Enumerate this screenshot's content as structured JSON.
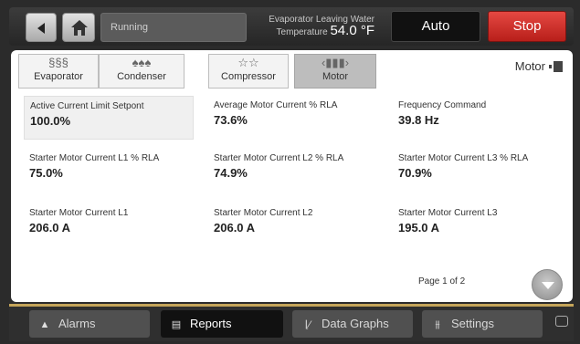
{
  "header": {
    "status": "Running",
    "temperature": {
      "label_line1": "Evaporator Leaving Water",
      "label_line2": "Temperature",
      "value": "54.0 °F"
    },
    "auto_label": "Auto",
    "stop_label": "Stop"
  },
  "tabs": [
    {
      "label": "Evaporator",
      "icon": "evaporator-icon"
    },
    {
      "label": "Condenser",
      "icon": "condenser-icon"
    },
    {
      "label": "Compressor",
      "icon": "compressor-icon"
    },
    {
      "label": "Motor",
      "icon": "motor-icon"
    }
  ],
  "section": {
    "title": "Motor",
    "icon": "motor-icon"
  },
  "cells": [
    {
      "label": "Active Current Limit Setpont",
      "value": "100.0%"
    },
    {
      "label": "Average Motor Current % RLA",
      "value": "73.6%"
    },
    {
      "label": "Frequency Command",
      "value": "39.8 Hz"
    },
    {
      "label": "Starter Motor Current L1 % RLA",
      "value": "75.0%"
    },
    {
      "label": "Starter Motor Current L2 % RLA",
      "value": "74.9%"
    },
    {
      "label": "Starter Motor Current L3 % RLA",
      "value": "70.9%"
    },
    {
      "label": "Starter Motor Current L1",
      "value": "206.0 A"
    },
    {
      "label": "Starter Motor Current L2",
      "value": "206.0 A"
    },
    {
      "label": "Starter Motor Current L3",
      "value": "195.0 A"
    }
  ],
  "pagination": {
    "label": "Page 1 of 2"
  },
  "nav": {
    "alarms": "Alarms",
    "reports": "Reports",
    "data_graphs": "Data Graphs",
    "settings": "Settings"
  }
}
